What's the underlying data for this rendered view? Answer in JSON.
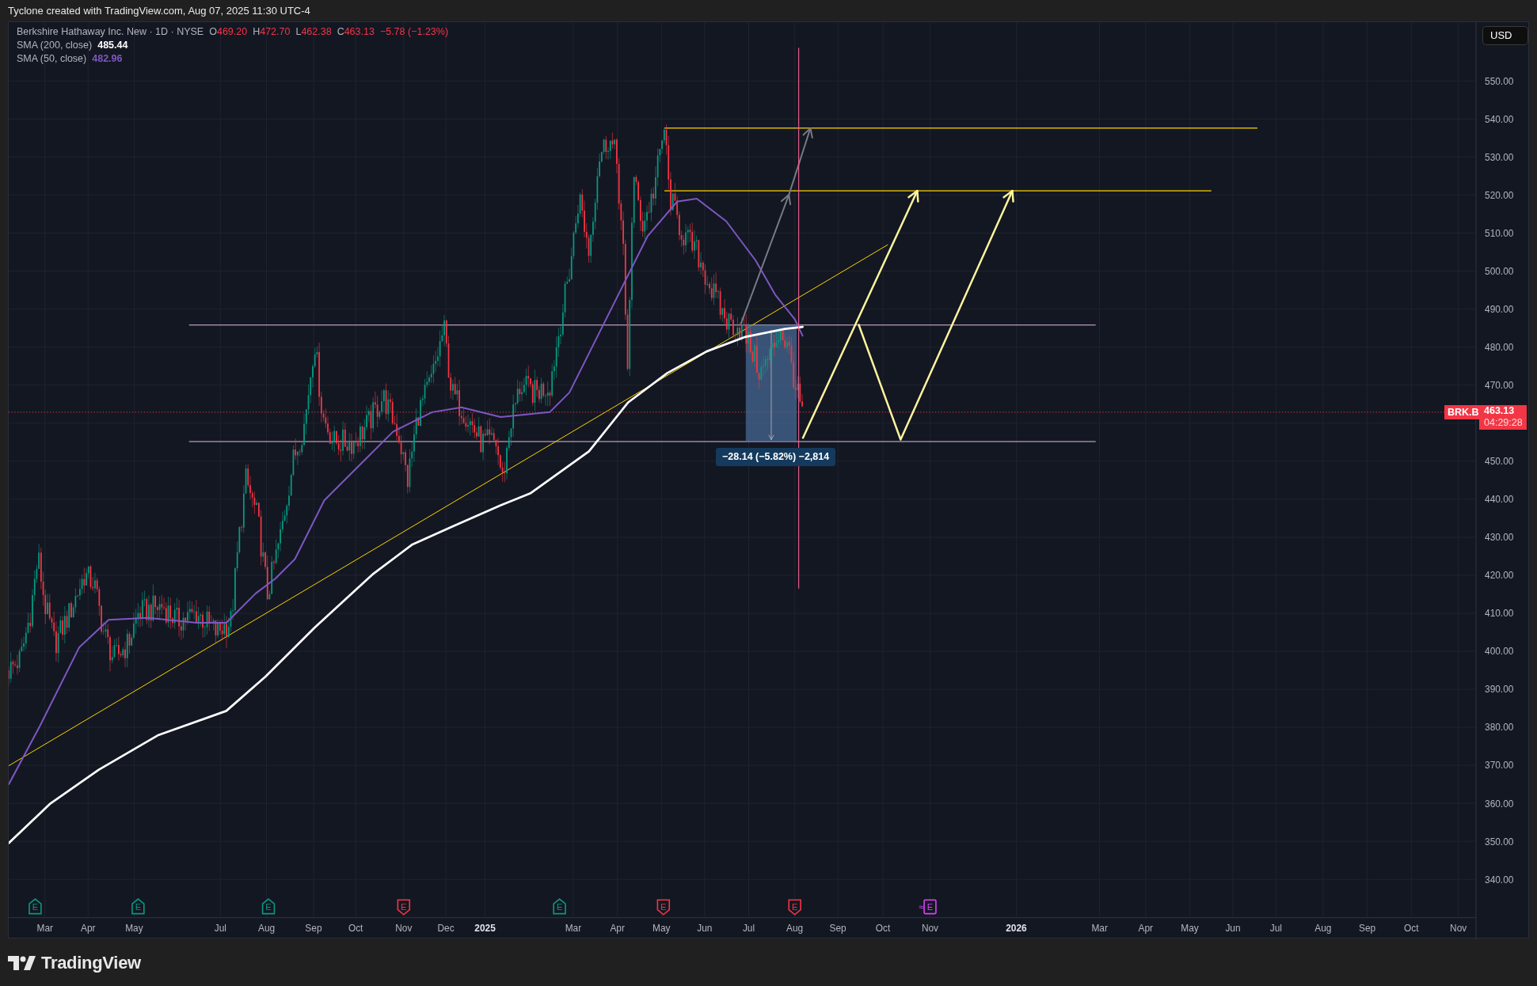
{
  "header": {
    "text": "Tyclone created with TradingView.com, Aug 07, 2025 11:30 UTC-4"
  },
  "legend": {
    "symbol": "Berkshire Hathaway Inc. New · 1D · NYSE",
    "ohlc": [
      {
        "key": "O",
        "value": "469.20"
      },
      {
        "key": "H",
        "value": "472.70"
      },
      {
        "key": "L",
        "value": "462.38"
      },
      {
        "key": "C",
        "value": "463.13"
      }
    ],
    "change": "−5.78 (−1.23%)"
  },
  "indicators": [
    {
      "label": "SMA (200, close)",
      "value": "485.44",
      "color": "#ffffff"
    },
    {
      "label": "SMA (50, close)",
      "value": "482.96",
      "color": "#7e57c2"
    }
  ],
  "currency": "USD",
  "price_axis": {
    "labels": [
      "550.00",
      "540.00",
      "530.00",
      "520.00",
      "510.00",
      "500.00",
      "490.00",
      "480.00",
      "470.00",
      "450.00",
      "440.00",
      "430.00",
      "420.00",
      "410.00",
      "400.00",
      "390.00",
      "380.00",
      "370.00",
      "360.00",
      "350.00",
      "340.00"
    ]
  },
  "time_axis": {
    "labels": [
      {
        "text": "Mar",
        "kind": "month"
      },
      {
        "text": "Apr",
        "kind": "month"
      },
      {
        "text": "May",
        "kind": "month"
      },
      {
        "text": "Jul",
        "kind": "month"
      },
      {
        "text": "Aug",
        "kind": "month"
      },
      {
        "text": "Sep",
        "kind": "month"
      },
      {
        "text": "Oct",
        "kind": "month"
      },
      {
        "text": "Nov",
        "kind": "month"
      },
      {
        "text": "Dec",
        "kind": "month"
      },
      {
        "text": "2025",
        "kind": "year"
      },
      {
        "text": "Mar",
        "kind": "month"
      },
      {
        "text": "Apr",
        "kind": "month"
      },
      {
        "text": "May",
        "kind": "month"
      },
      {
        "text": "Jun",
        "kind": "month"
      },
      {
        "text": "Jul",
        "kind": "month"
      },
      {
        "text": "Aug",
        "kind": "month"
      },
      {
        "text": "Sep",
        "kind": "month"
      },
      {
        "text": "Oct",
        "kind": "month"
      },
      {
        "text": "Nov",
        "kind": "month"
      },
      {
        "text": "2026",
        "kind": "year"
      },
      {
        "text": "Mar",
        "kind": "month"
      },
      {
        "text": "Apr",
        "kind": "month"
      },
      {
        "text": "May",
        "kind": "month"
      },
      {
        "text": "Jun",
        "kind": "month"
      },
      {
        "text": "Jul",
        "kind": "month"
      },
      {
        "text": "Aug",
        "kind": "month"
      },
      {
        "text": "Sep",
        "kind": "month"
      },
      {
        "text": "Oct",
        "kind": "month"
      },
      {
        "text": "Nov",
        "kind": "month"
      }
    ]
  },
  "events": [
    {
      "label": "E",
      "kind": "beat",
      "color": "#089981"
    },
    {
      "label": "E",
      "kind": "beat",
      "color": "#089981"
    },
    {
      "label": "E",
      "kind": "beat",
      "color": "#089981"
    },
    {
      "label": "E",
      "kind": "miss",
      "color": "#f23645"
    },
    {
      "label": "E",
      "kind": "beat",
      "color": "#089981"
    },
    {
      "label": "E",
      "kind": "miss",
      "color": "#f23645"
    },
    {
      "label": "E",
      "kind": "miss",
      "color": "#f23645"
    },
    {
      "label": "E",
      "kind": "upcoming",
      "prefix": "≈",
      "color": "#e040fb"
    }
  ],
  "price_tag": {
    "symbol": "BRK.B",
    "price": "463.13",
    "countdown": "04:29:28"
  },
  "measurement": {
    "text": "−28.14 (−5.82%) −2,814"
  },
  "brand": {
    "text": "TradingView"
  }
}
